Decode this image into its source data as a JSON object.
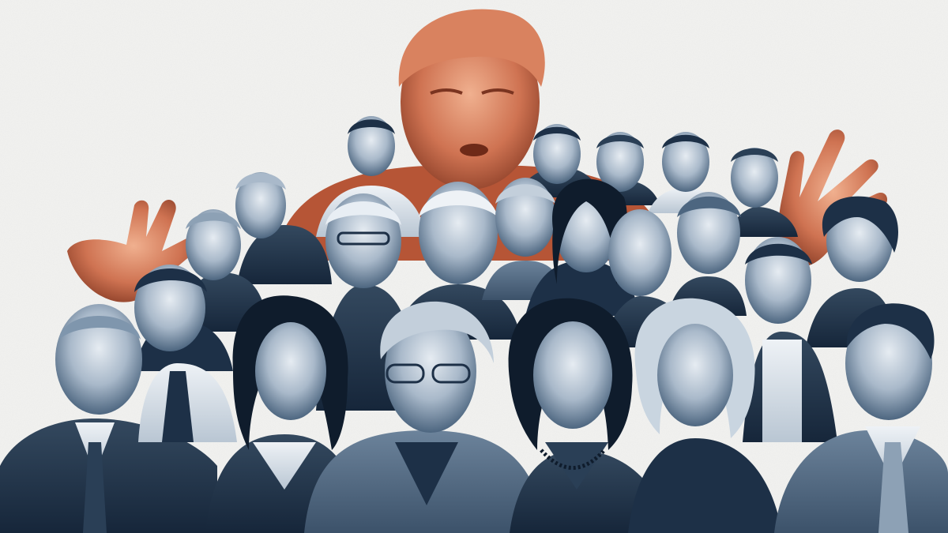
{
  "image": {
    "kind": "photo-collage",
    "palette": {
      "paper": "#f2f2f0",
      "accent_orange": "#c8674a",
      "accent_orange_dark": "#9e4a30",
      "duotone_light": "#dfe6ee",
      "duotone_mid": "#7f96ad",
      "duotone_dark": "#1d3047",
      "duotone_deepest": "#0f1c2c"
    },
    "figures": {
      "center_top": {
        "tone": "orange",
        "pose": "gesturing-with-both-hands"
      },
      "crowd_count": 20,
      "crowd_tone": "blue-duotone"
    }
  }
}
